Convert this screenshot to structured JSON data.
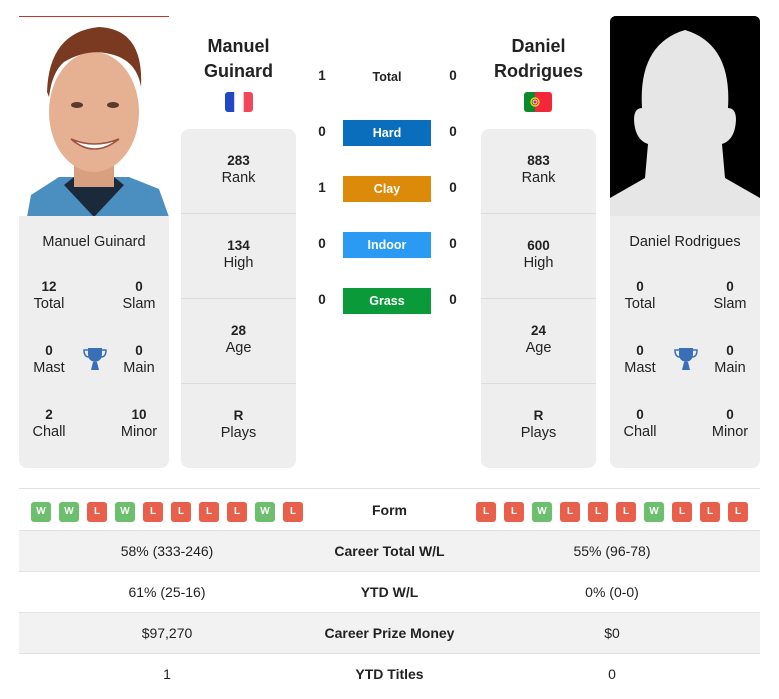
{
  "player1": {
    "name_line1": "Manuel",
    "name_line2": "Guinard",
    "full_name": "Manuel Guinard",
    "flag": "france-flag",
    "photo": "player-photo",
    "rank": {
      "value": "283",
      "label": "Rank"
    },
    "high": {
      "value": "134",
      "label": "High"
    },
    "age": {
      "value": "28",
      "label": "Age"
    },
    "plays": {
      "value": "R",
      "label": "Plays"
    },
    "titles": {
      "total": {
        "value": "12",
        "label": "Total"
      },
      "slam": {
        "value": "0",
        "label": "Slam"
      },
      "mast": {
        "value": "0",
        "label": "Mast"
      },
      "main": {
        "value": "0",
        "label": "Main"
      },
      "chall": {
        "value": "2",
        "label": "Chall"
      },
      "minor": {
        "value": "10",
        "label": "Minor"
      }
    },
    "form": [
      "W",
      "W",
      "L",
      "W",
      "L",
      "L",
      "L",
      "L",
      "W",
      "L"
    ]
  },
  "player2": {
    "name_line1": "Daniel",
    "name_line2": "Rodrigues",
    "full_name": "Daniel Rodrigues",
    "flag": "portugal-flag",
    "photo": "silhouette-placeholder",
    "rank": {
      "value": "883",
      "label": "Rank"
    },
    "high": {
      "value": "600",
      "label": "High"
    },
    "age": {
      "value": "24",
      "label": "Age"
    },
    "plays": {
      "value": "R",
      "label": "Plays"
    },
    "titles": {
      "total": {
        "value": "0",
        "label": "Total"
      },
      "slam": {
        "value": "0",
        "label": "Slam"
      },
      "mast": {
        "value": "0",
        "label": "Mast"
      },
      "main": {
        "value": "0",
        "label": "Main"
      },
      "chall": {
        "value": "0",
        "label": "Chall"
      },
      "minor": {
        "value": "0",
        "label": "Minor"
      }
    },
    "form": [
      "L",
      "L",
      "W",
      "L",
      "L",
      "L",
      "W",
      "L",
      "L",
      "L"
    ]
  },
  "h2h": {
    "total": {
      "label": "Total",
      "p1": "1",
      "p2": "0"
    },
    "surfaces": [
      {
        "label": "Hard",
        "p1": "0",
        "p2": "0",
        "color": "#0a6ebd"
      },
      {
        "label": "Clay",
        "p1": "1",
        "p2": "0",
        "color": "#dc8a0a"
      },
      {
        "label": "Indoor",
        "p1": "0",
        "p2": "0",
        "color": "#2b9af3"
      },
      {
        "label": "Grass",
        "p1": "0",
        "p2": "0",
        "color": "#0a9a3a"
      }
    ]
  },
  "comparison": {
    "form_label": "Form",
    "rows": [
      {
        "label": "Career Total W/L",
        "p1": "58% (333-246)",
        "p2": "55% (96-78)"
      },
      {
        "label": "YTD W/L",
        "p1": "61% (25-16)",
        "p2": "0% (0-0)"
      },
      {
        "label": "Career Prize Money",
        "p1": "$97,270",
        "p2": "$0"
      },
      {
        "label": "YTD Titles",
        "p1": "1",
        "p2": "0"
      }
    ]
  },
  "colors": {
    "win": "#6cbf6c",
    "loss": "#e8604c",
    "trophy": "#3a6fb7"
  }
}
